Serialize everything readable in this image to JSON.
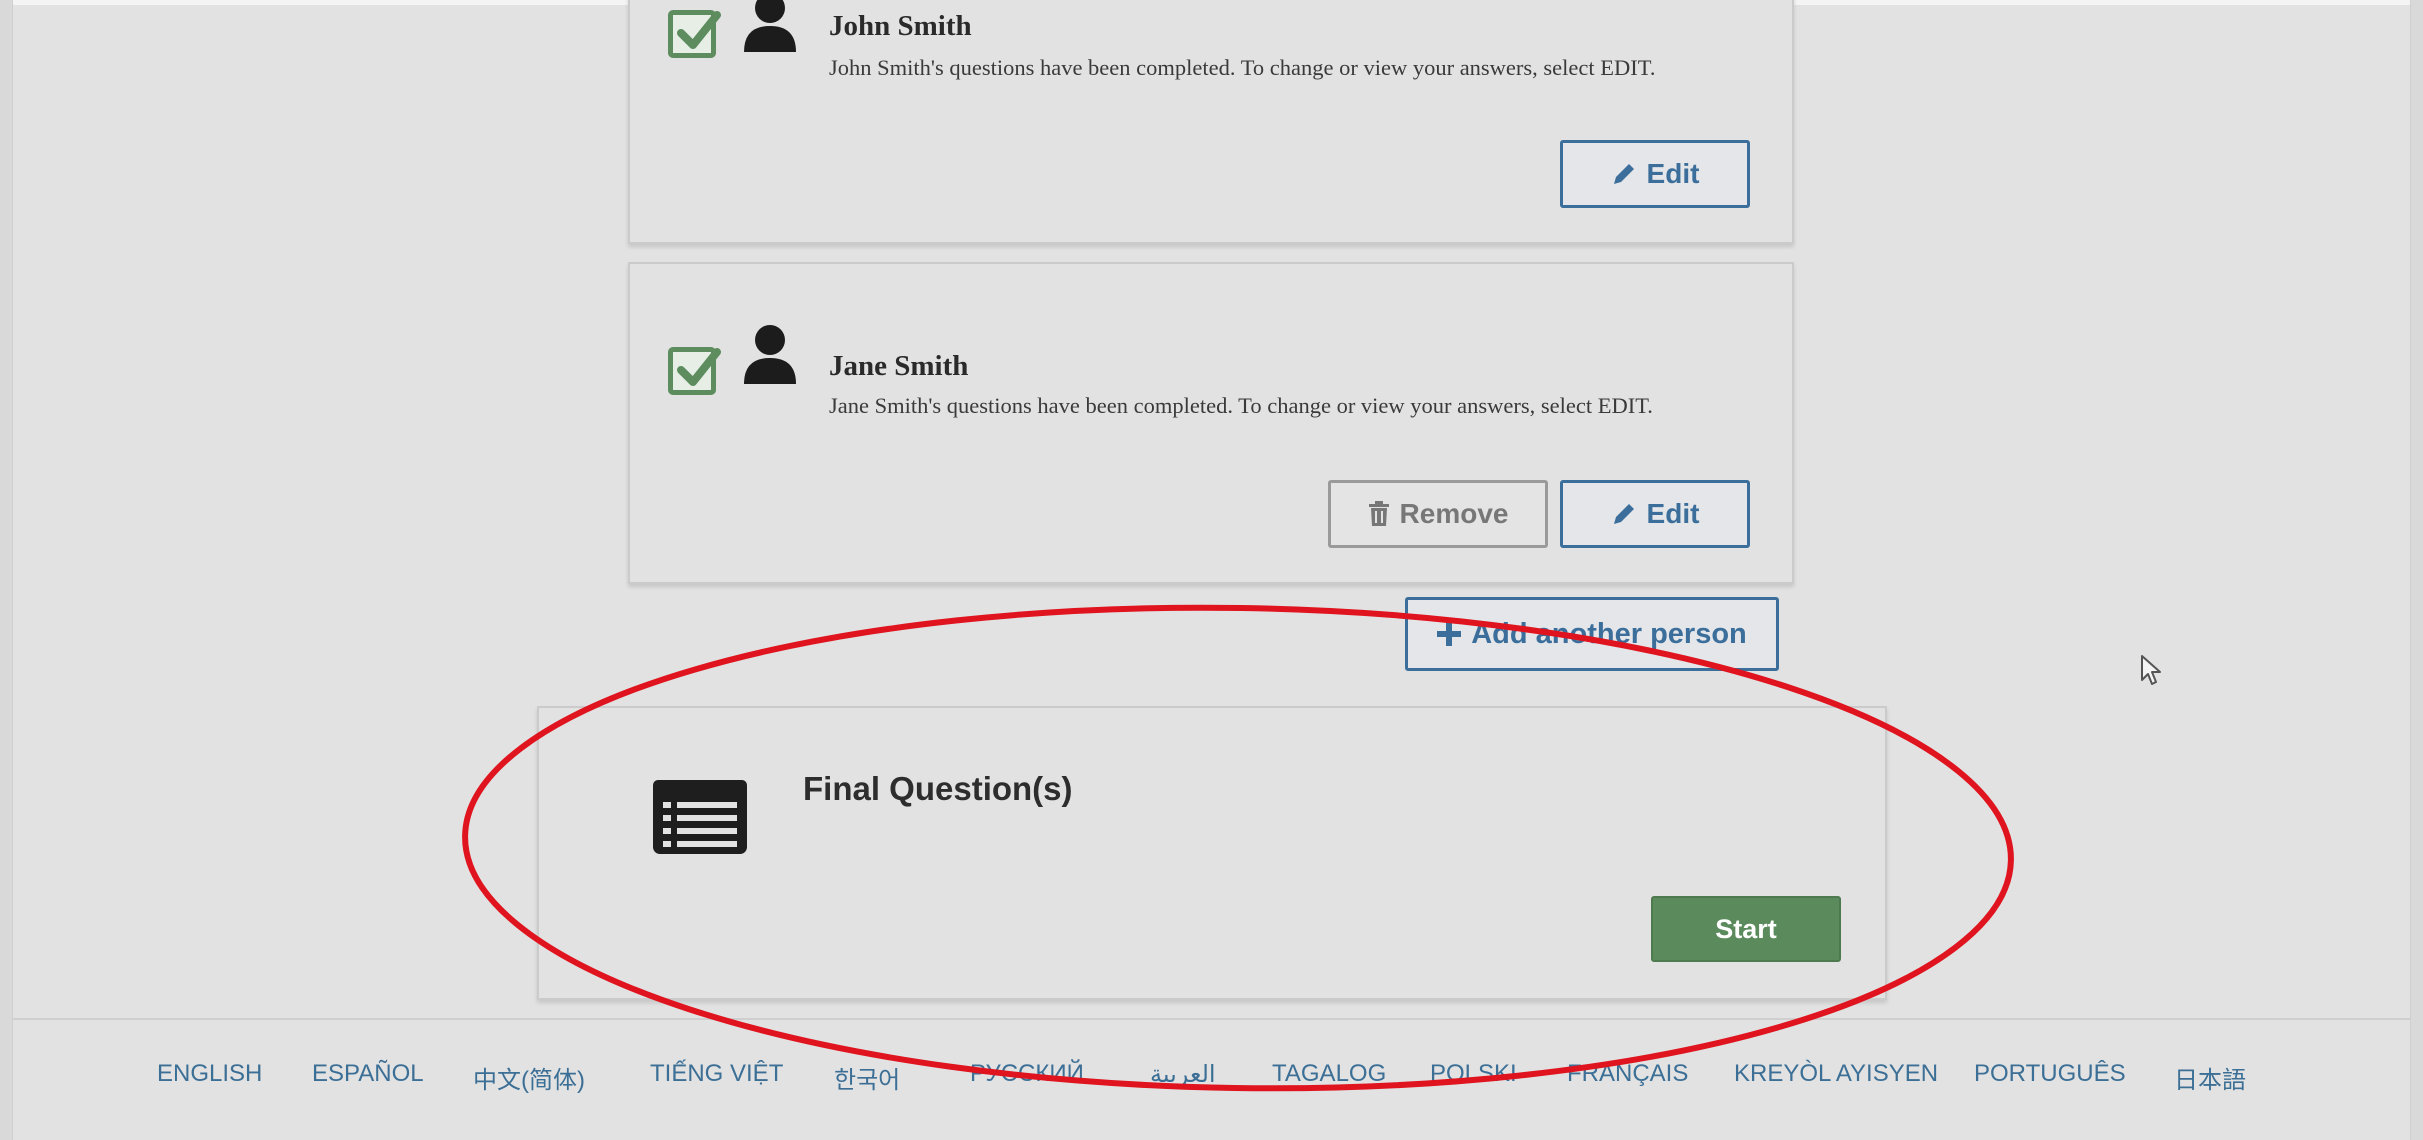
{
  "people": [
    {
      "name": "John Smith",
      "description": "John Smith's questions have been completed. To change or view your answers, select EDIT.",
      "edit_label": "Edit"
    },
    {
      "name": "Jane Smith",
      "description": "Jane Smith's questions have been completed. To change or view your answers, select EDIT.",
      "remove_label": "Remove",
      "edit_label": "Edit"
    }
  ],
  "add_person_label": "Add another person",
  "final": {
    "title": "Final Question(s)",
    "start_label": "Start"
  },
  "languages": [
    "ENGLISH",
    "ESPAÑOL",
    "中文(简体)",
    "TIẾNG VIỆT",
    "한국어",
    "РУССКИЙ",
    "العربية",
    "TAGALOG",
    "POLSKI",
    "FRANÇAIS",
    "KREYÒL AYISYEN",
    "PORTUGUÊS",
    "日本語"
  ],
  "colors": {
    "accent_blue": "#3b6e9a",
    "start_green": "#5b8a5d",
    "annotation_red": "#e0141e",
    "check_green": "#5d8d5f"
  },
  "icons": {
    "check": "checkbox-checked-icon",
    "person": "person-icon",
    "edit": "pencil-icon",
    "remove": "trash-icon",
    "add": "plus-icon",
    "final": "list-icon"
  }
}
